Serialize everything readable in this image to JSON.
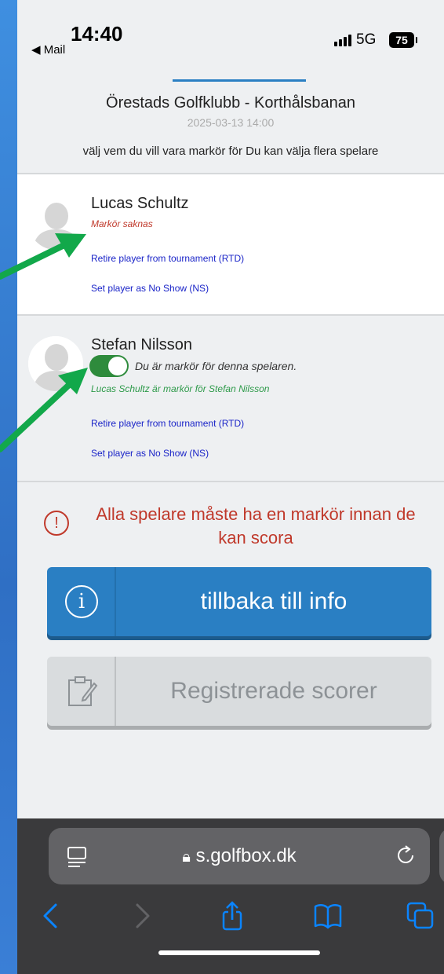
{
  "status_bar": {
    "time": "14:40",
    "back_app": "◀ Mail",
    "network": "5G",
    "battery": "75"
  },
  "header": {
    "course": "Örestads Golfklubb - Korthålsbanan",
    "datetime": "2025-03-13 14:00",
    "instruction": "välj vem du vill vara markör för Du kan välja flera spelare"
  },
  "players": [
    {
      "name": "Lucas Schultz",
      "marker_status": "Markör saknas",
      "retire_link": "Retire player from tournament (RTD)",
      "noshow_link": "Set player as No Show (NS)"
    },
    {
      "name": "Stefan Nilsson",
      "toggle_label": "Du är markör för denna spelaren.",
      "marker_status": "Lucas Schultz är markör för Stefan Nilsson",
      "retire_link": "Retire player from tournament (RTD)",
      "noshow_link": "Set player as No Show (NS)",
      "toggle_on": true
    }
  ],
  "warning": {
    "icon": "!",
    "text": "Alla spelare måste ha en markör innan de kan scora"
  },
  "buttons": {
    "info_label": "tillbaka till info",
    "info_icon": "i",
    "scores_label": "Registrerade scorer"
  },
  "browser": {
    "url": "s.golfbox.dk"
  },
  "colors": {
    "accent": "#2a7fc3",
    "warning": "#c0392b",
    "toggle_on": "#2e8b3c",
    "link": "#1a24c8",
    "annotation_arrow": "#12a84a"
  }
}
